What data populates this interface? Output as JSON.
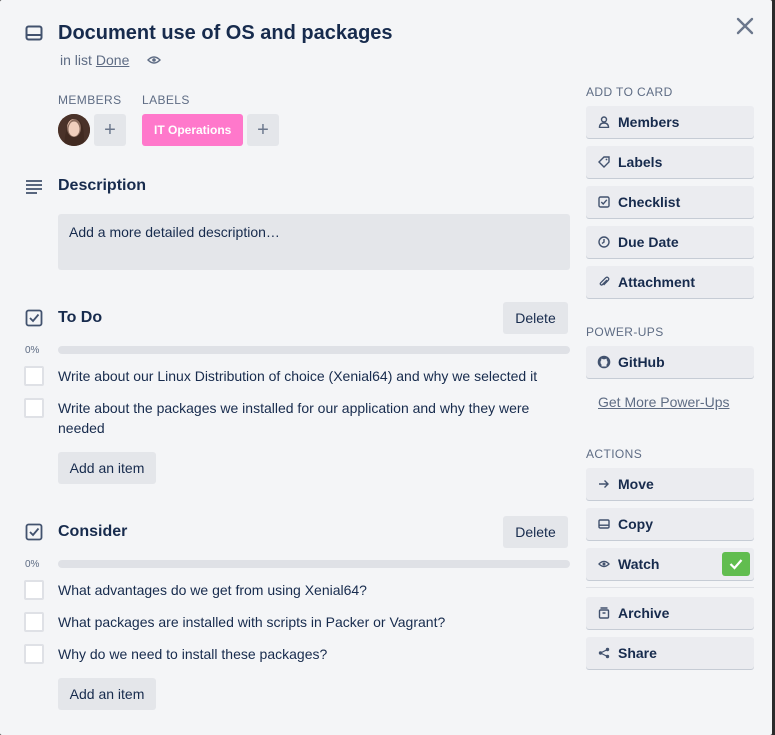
{
  "card": {
    "title": "Document use of OS and packages",
    "in_list_prefix": "in list",
    "list_name": "Done"
  },
  "members": {
    "header": "MEMBERS"
  },
  "labels": {
    "header": "LABELS",
    "items": [
      {
        "text": "IT Operations",
        "color": "#ff78cb"
      }
    ]
  },
  "description": {
    "title": "Description",
    "placeholder": "Add a more detailed description…"
  },
  "checklists": [
    {
      "title": "To Do",
      "delete_label": "Delete",
      "progress_text": "0%",
      "progress": 0,
      "items": [
        "Write about our Linux Distribution of choice (Xenial64) and why we selected it",
        "Write about the packages we installed for our application and why they were needed"
      ],
      "add_label": "Add an item"
    },
    {
      "title": "Consider",
      "delete_label": "Delete",
      "progress_text": "0%",
      "progress": 0,
      "items": [
        "What advantages do we get from using Xenial64?",
        "What packages are installed with scripts in Packer or Vagrant?",
        "Why do we need to install these packages?"
      ],
      "add_label": "Add an item"
    }
  ],
  "sidebar": {
    "add_to_card_header": "ADD TO CARD",
    "add_to_card": [
      {
        "label": "Members",
        "icon": "person-icon"
      },
      {
        "label": "Labels",
        "icon": "tag-icon"
      },
      {
        "label": "Checklist",
        "icon": "checkbox-icon"
      },
      {
        "label": "Due Date",
        "icon": "clock-icon"
      },
      {
        "label": "Attachment",
        "icon": "paperclip-icon"
      }
    ],
    "powerups_header": "POWER-UPS",
    "powerups": [
      {
        "label": "GitHub",
        "icon": "github-icon"
      }
    ],
    "get_more_link": "Get More Power-Ups",
    "actions_header": "ACTIONS",
    "actions": [
      {
        "label": "Move",
        "icon": "arrow-right-icon"
      },
      {
        "label": "Copy",
        "icon": "copy-icon"
      },
      {
        "label": "Watch",
        "icon": "eye-icon",
        "checked": true
      },
      {
        "label": "Archive",
        "icon": "archive-icon"
      },
      {
        "label": "Share",
        "icon": "share-icon"
      }
    ]
  },
  "colors": {
    "modal_bg": "#f4f5f7",
    "button_bg": "#ebecf0",
    "watch_check": "#61bd4f",
    "label_pink": "#ff78cb"
  }
}
